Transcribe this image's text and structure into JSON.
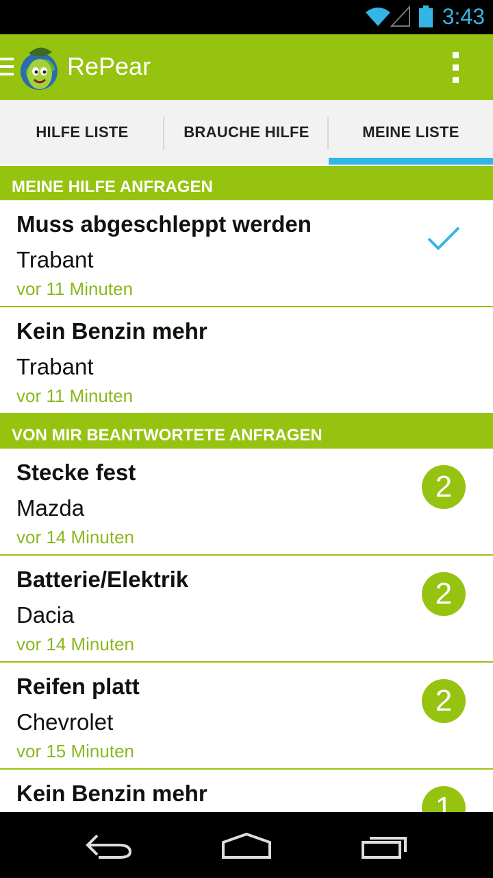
{
  "status_bar": {
    "time": "3:43",
    "icons": [
      "wifi-icon",
      "signal-icon",
      "battery-icon"
    ]
  },
  "action_bar": {
    "title": "RePear",
    "menu_icon": "overflow-menu-icon",
    "drawer_icon": "drawer-icon"
  },
  "tabs": [
    {
      "label": "HILFE LISTE",
      "active": false
    },
    {
      "label": "BRAUCHE HILFE",
      "active": false
    },
    {
      "label": "MEINE LISTE",
      "active": true
    }
  ],
  "sections": [
    {
      "header": "MEINE HILFE ANFRAGEN",
      "items": [
        {
          "title": "Muss abgeschleppt werden",
          "car": "Trabant",
          "time": "vor 11 Minuten",
          "indicator": "check-icon"
        },
        {
          "title": "Kein Benzin mehr",
          "car": "Trabant",
          "time": "vor 11 Minuten"
        }
      ]
    },
    {
      "header": "VON MIR BEANTWORTETE ANFRAGEN",
      "items": [
        {
          "title": "Stecke fest",
          "car": "Mazda",
          "time": "vor 14 Minuten",
          "count": "2"
        },
        {
          "title": "Batterie/Elektrik",
          "car": "Dacia",
          "time": "vor 14 Minuten",
          "count": "2"
        },
        {
          "title": "Reifen platt",
          "car": "Chevrolet",
          "time": "vor 15 Minuten",
          "count": "2"
        },
        {
          "title": "Kein Benzin mehr",
          "count": "1"
        }
      ]
    }
  ],
  "colors": {
    "brand_green": "#96c30f",
    "accent_blue": "#33b5e5",
    "time_green": "#8ab81e"
  }
}
